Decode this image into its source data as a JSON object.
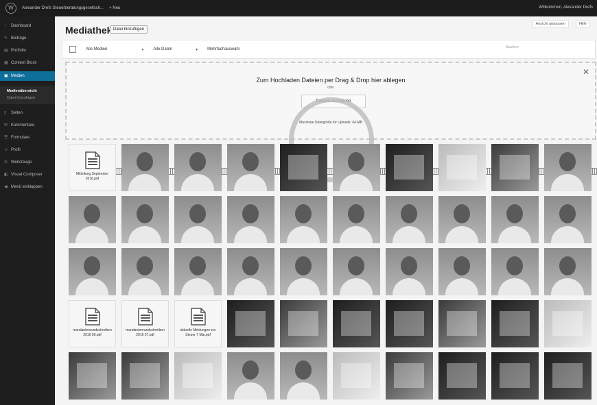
{
  "adminbar": {
    "site_name": "Alexander Drefs Steuerberatungsgesellsch...",
    "new_label": "+ Neu",
    "greeting": "Willkommen, Alexander Drefs"
  },
  "sidebar": {
    "items": [
      {
        "label": "Dashboard",
        "icon": "dashboard-icon"
      },
      {
        "label": "Beiträge",
        "icon": "pin-icon"
      },
      {
        "label": "Portfolio",
        "icon": "portfolio-icon"
      },
      {
        "label": "Content Block",
        "icon": "block-icon"
      },
      {
        "label": "Medien",
        "icon": "media-icon"
      },
      {
        "label": "Seiten",
        "icon": "pages-icon"
      },
      {
        "label": "Kommentare",
        "icon": "comments-icon"
      },
      {
        "label": "Formulare",
        "icon": "forms-icon"
      },
      {
        "label": "Profil",
        "icon": "user-icon"
      },
      {
        "label": "Werkzeuge",
        "icon": "wrench-icon"
      },
      {
        "label": "Visual Composer",
        "icon": "composer-icon"
      },
      {
        "label": "Menü einklappen",
        "icon": "collapse-icon"
      }
    ],
    "submenu": [
      "Medienübersicht",
      "Datei hinzufügen"
    ]
  },
  "header": {
    "title": "Mediathek",
    "add_new": "Datei hinzufügen",
    "screen_options": "Ansicht anpassen",
    "help": "Hilfe"
  },
  "filters": {
    "media_type": "Alle Medien",
    "dates": "Alle Daten",
    "bulk": "Mehrfachauswahl",
    "search_placeholder": "Suchen"
  },
  "dropzone": {
    "title": "Zum Hochladen Dateien per Drag & Drop hier ablegen",
    "or": "oder",
    "button": "Dateien auswählen",
    "max_size": "Maximale Dateigröße für Uploads: 64 MB"
  },
  "media": [
    {
      "type": "doc",
      "name": "Mitteilung September 2016.pdf"
    },
    {
      "type": "portrait"
    },
    {
      "type": "portrait"
    },
    {
      "type": "portrait"
    },
    {
      "type": "photo",
      "tone": "dark"
    },
    {
      "type": "portrait"
    },
    {
      "type": "photo",
      "tone": "dark"
    },
    {
      "type": "photo",
      "tone": "light"
    },
    {
      "type": "photo"
    },
    {
      "type": "portrait"
    },
    {
      "type": "portrait"
    },
    {
      "type": "portrait"
    },
    {
      "type": "portrait"
    },
    {
      "type": "portrait"
    },
    {
      "type": "portrait"
    },
    {
      "type": "portrait"
    },
    {
      "type": "portrait"
    },
    {
      "type": "portrait"
    },
    {
      "type": "portrait"
    },
    {
      "type": "portrait"
    },
    {
      "type": "portrait"
    },
    {
      "type": "portrait"
    },
    {
      "type": "portrait"
    },
    {
      "type": "portrait"
    },
    {
      "type": "portrait"
    },
    {
      "type": "portrait"
    },
    {
      "type": "portrait"
    },
    {
      "type": "portrait"
    },
    {
      "type": "portrait"
    },
    {
      "type": "portrait"
    },
    {
      "type": "doc",
      "name": "mandantenrundschreiben 2016 06.pdf"
    },
    {
      "type": "doc",
      "name": "mandantenrundschreiben 2016 07.pdf"
    },
    {
      "type": "doc",
      "name": "aktuelle Meldungen zur Steuer 7 Mai.pdf"
    },
    {
      "type": "photo",
      "tone": "dark"
    },
    {
      "type": "photo"
    },
    {
      "type": "photo",
      "tone": "dark"
    },
    {
      "type": "photo",
      "tone": "dark"
    },
    {
      "type": "photo"
    },
    {
      "type": "photo",
      "tone": "dark"
    },
    {
      "type": "photo",
      "tone": "light"
    },
    {
      "type": "photo"
    },
    {
      "type": "photo"
    },
    {
      "type": "photo",
      "tone": "light"
    },
    {
      "type": "portrait"
    },
    {
      "type": "portrait"
    },
    {
      "type": "photo",
      "tone": "light"
    },
    {
      "type": "photo"
    },
    {
      "type": "photo",
      "tone": "dark"
    },
    {
      "type": "photo",
      "tone": "dark"
    },
    {
      "type": "photo",
      "tone": "dark"
    }
  ],
  "colors": {
    "sidebar_bg": "#1e1e1e",
    "active_menu": "#0f6f9b",
    "adminbar_bg": "#1c1c1c"
  }
}
